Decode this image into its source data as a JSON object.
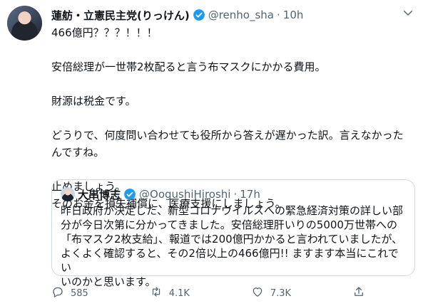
{
  "tweet": {
    "author_name": "蓮舫・立憲民主党(りっけん)",
    "handle": "@renho_sha",
    "separator": "·",
    "time": "10h",
    "lines": [
      "466億円？？？！！！",
      "",
      "安倍総理が一世帯2枚配ると言う布マスクにかかる費用。",
      "",
      "財源は税金です。",
      "",
      "どうりで、何度問い合わせても役所から答えが遅かった訳。言えなかった",
      "んですね。",
      "",
      "止めましょう。",
      "そのお金を損失補償に、医療支援にしましょう。"
    ]
  },
  "quote": {
    "author_name": "大串博志",
    "handle": "@OogushiHiroshi",
    "separator": "·",
    "time": "17h",
    "lines": [
      "昨日政府が決定した、新型コロナウイルスへの緊急経済対策の詳しい部",
      "分が今日次第に分かってきました。安倍総理肝いりの5000万世帯への",
      "「布マスク2枚支給」、報道では200億円かかると言われていましたが、",
      "よくよく確認すると、その2倍以上の466億円!! ますます本当にこれでい",
      "いのかと思います。"
    ]
  },
  "actions": {
    "reply_count": "585",
    "retweet_count": "4.1K",
    "like_count": "7.3K"
  },
  "colors": {
    "verified": "#1d9bf0",
    "secondary_text": "#536471",
    "border": "#cfd9de"
  },
  "icons": [
    "verified-badge-icon",
    "chevron-down-icon",
    "reply-icon",
    "retweet-icon",
    "like-icon",
    "share-icon"
  ]
}
